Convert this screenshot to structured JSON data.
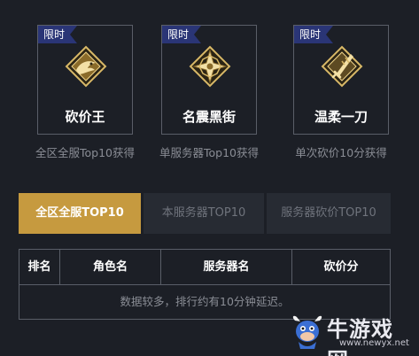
{
  "badges": [
    {
      "tag": "限时",
      "name": "砍价王",
      "desc": "全区全服Top10获得",
      "icon": "dragon-emblem-icon"
    },
    {
      "tag": "限时",
      "name": "名震黑街",
      "desc": "单服务器Top10获得",
      "icon": "star-emblem-icon"
    },
    {
      "tag": "限时",
      "name": "温柔一刀",
      "desc": "单次砍价10分获得",
      "icon": "blade-emblem-icon"
    }
  ],
  "tabs": [
    {
      "label": "全区全服TOP10",
      "active": true
    },
    {
      "label": "本服务器TOP10",
      "active": false
    },
    {
      "label": "服务器砍价TOP10",
      "active": false
    }
  ],
  "table": {
    "headers": [
      "排名",
      "角色名",
      "服务器名",
      "砍价分"
    ],
    "note": "数据较多，排行约有10分钟延迟。"
  },
  "watermark": {
    "brand": "牛游戏网",
    "url": "www.newyx.net"
  },
  "colors": {
    "background": "#1c1f26",
    "accent": "#c69a3f",
    "tag": "#2a3576",
    "border": "#5a5e68"
  }
}
